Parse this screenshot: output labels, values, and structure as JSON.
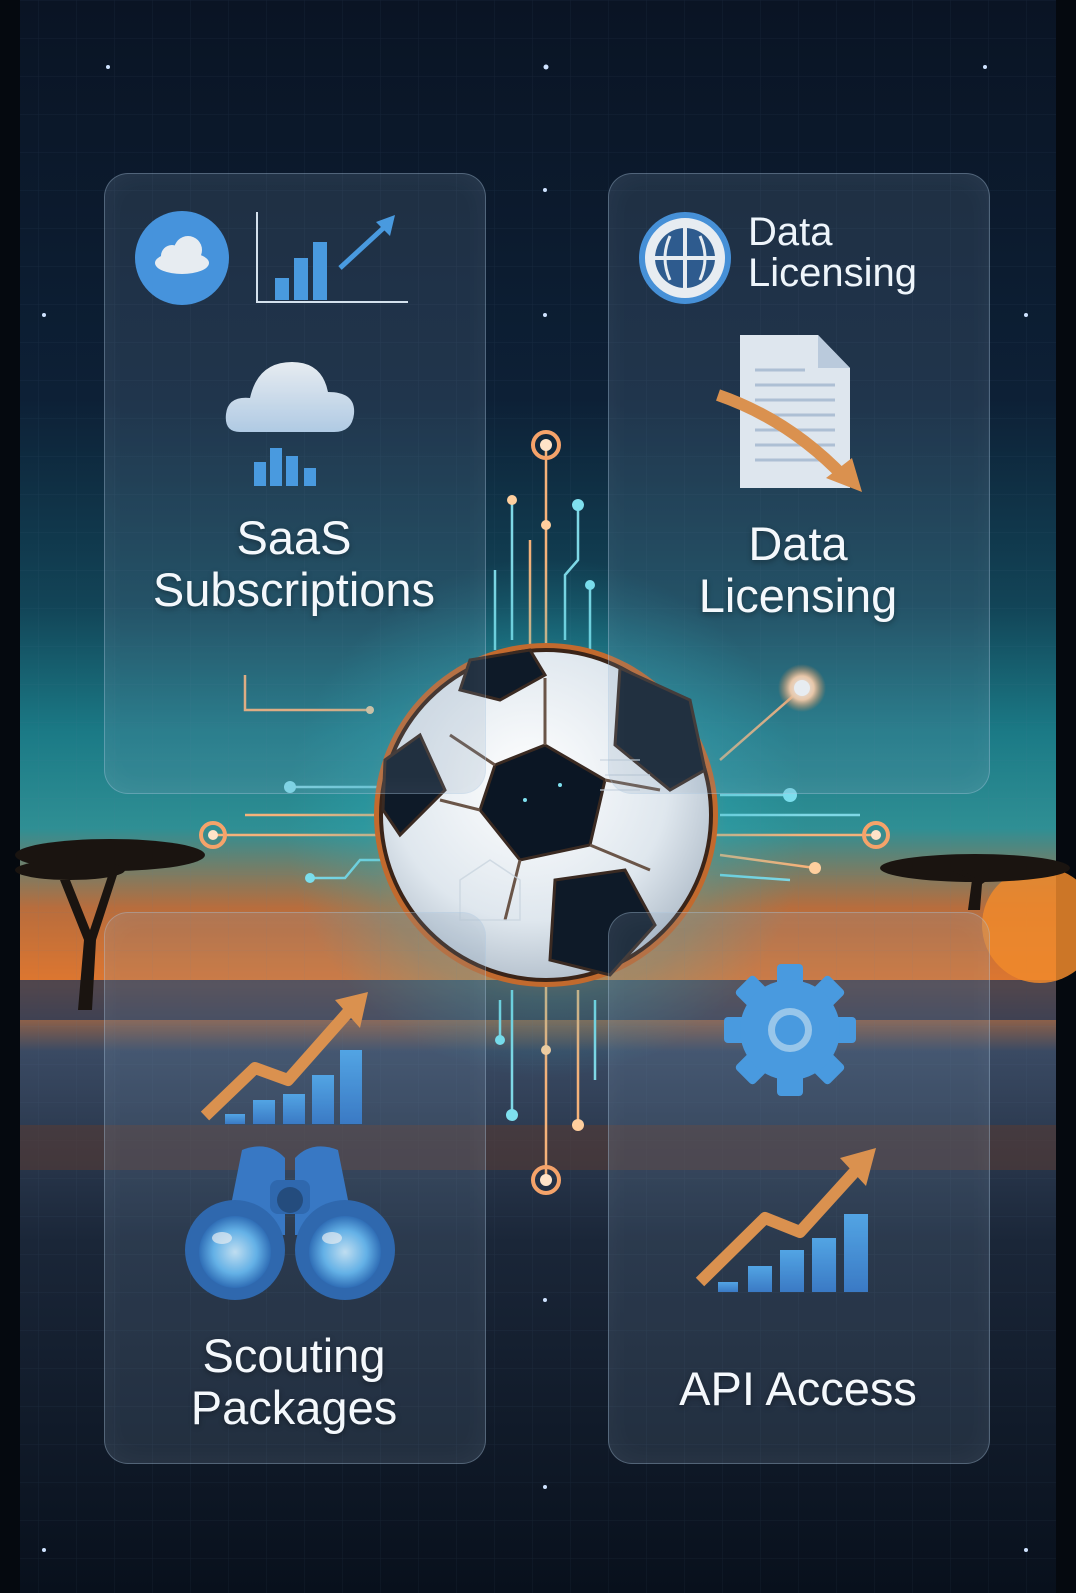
{
  "panels": {
    "saas": {
      "title": "SaaS\nSubscriptions"
    },
    "data_licensing": {
      "header": "Data\nLicensing",
      "title": "Data\nLicensing"
    },
    "scouting": {
      "title": "Scouting\nPackages"
    },
    "api": {
      "title": "API Access"
    }
  },
  "colors": {
    "background_top": "#0a1628",
    "horizon_orange": "#e0772f",
    "teal_glow": "#27b7c4",
    "accent_blue": "#3e9be8",
    "accent_orange": "#f0913a",
    "panel_border": "#bcd7f0"
  },
  "icons": [
    "cloud-icon",
    "growth-chart-icon",
    "globe-icon",
    "document-icon",
    "bar-chart-icon",
    "binoculars-icon",
    "gear-icon",
    "soccer-ball-icon"
  ]
}
